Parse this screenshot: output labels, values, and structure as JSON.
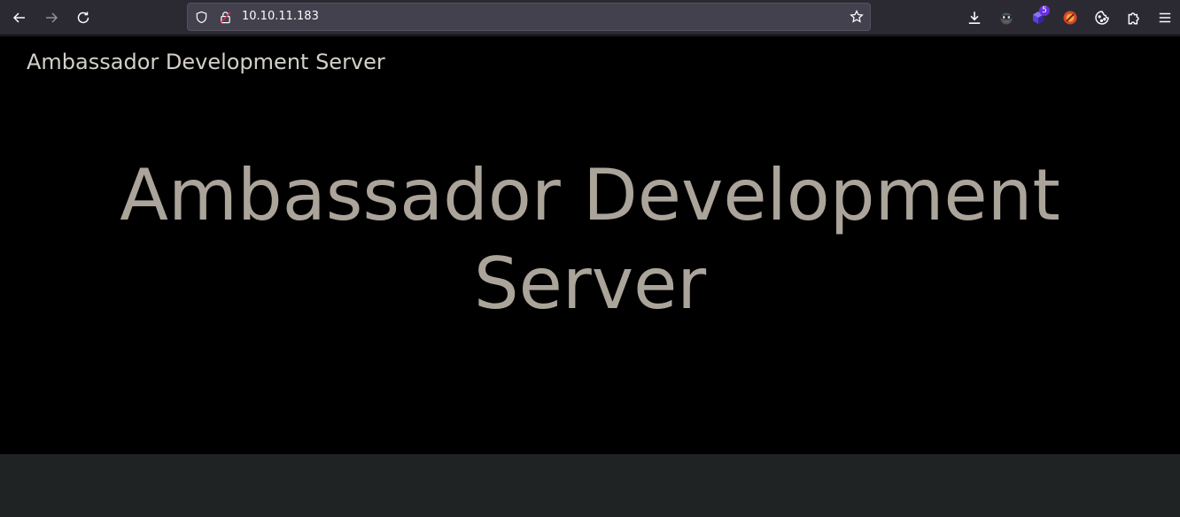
{
  "browser": {
    "url": "10.10.11.183",
    "extensions": [
      {
        "name": "download-icon"
      },
      {
        "name": "extension-mask-icon"
      },
      {
        "name": "extension-cube-icon",
        "badge": "5"
      },
      {
        "name": "extension-red-icon"
      },
      {
        "name": "cookie-icon"
      },
      {
        "name": "puzzle-icon"
      },
      {
        "name": "menu-icon"
      }
    ]
  },
  "page": {
    "brand": "Ambassador Development Server",
    "heading_line1": "Ambassador Development",
    "heading_line2": "Server"
  },
  "colors": {
    "toolbar_bg": "#2b2a33",
    "page_bg": "#000000",
    "heading_text": "#aba49b",
    "brand_text": "#d3cfc9",
    "footer_bg": "#202324"
  }
}
